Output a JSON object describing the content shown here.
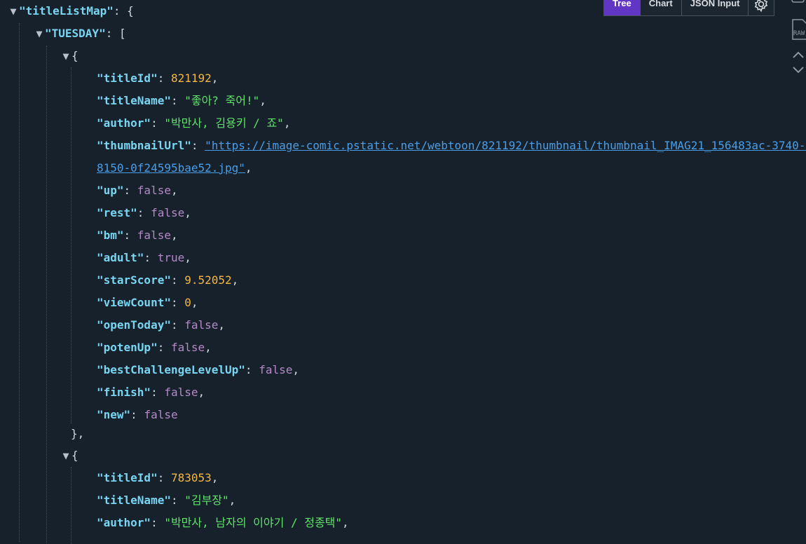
{
  "toolbar": {
    "tabs": [
      {
        "label": "Tree",
        "active": true
      },
      {
        "label": "Chart",
        "active": false
      },
      {
        "label": "JSON Input",
        "active": false
      }
    ],
    "settings_icon": "gear-icon"
  },
  "side_icons": [
    "raw-icon",
    "chevron-up-icon",
    "chevron-down-icon"
  ],
  "side_raw_label": "RAW",
  "colors": {
    "background": "#17212b",
    "key": "#78d6f2",
    "string": "#5fe36a",
    "number": "#f5b742",
    "boolean": "#b58ac7",
    "link": "#4a9ee8",
    "active_tab": "#6236c4"
  },
  "tree": {
    "root_key": "\"titleListMap\"",
    "root_open": ": {",
    "group_key": "\"TUESDAY\"",
    "group_open": ": [",
    "item1": {
      "open": "{",
      "fields": [
        {
          "key": "\"titleId\"",
          "value": "821192",
          "type": "num",
          "comma": ","
        },
        {
          "key": "\"titleName\"",
          "value": "\"좋아? 죽어!\"",
          "type": "str",
          "comma": ","
        },
        {
          "key": "\"author\"",
          "value": "\"박만사, 김용키 / 죠\"",
          "type": "str",
          "comma": ","
        },
        {
          "key": "\"thumbnailUrl\"",
          "value": "\"https://image-comic.pstatic.net/webtoon/821192/thumbnail/thumbnail_IMAG21_156483ac-3740-4cbf-",
          "value2": "8150-0f24595bae52.jpg\"",
          "type": "link",
          "comma": ","
        },
        {
          "key": "\"up\"",
          "value": "false",
          "type": "bool",
          "comma": ","
        },
        {
          "key": "\"rest\"",
          "value": "false",
          "type": "bool",
          "comma": ","
        },
        {
          "key": "\"bm\"",
          "value": "false",
          "type": "bool",
          "comma": ","
        },
        {
          "key": "\"adult\"",
          "value": "true",
          "type": "bool",
          "comma": ","
        },
        {
          "key": "\"starScore\"",
          "value": "9.52052",
          "type": "num",
          "comma": ","
        },
        {
          "key": "\"viewCount\"",
          "value": "0",
          "type": "num",
          "comma": ","
        },
        {
          "key": "\"openToday\"",
          "value": "false",
          "type": "bool",
          "comma": ","
        },
        {
          "key": "\"potenUp\"",
          "value": "false",
          "type": "bool",
          "comma": ","
        },
        {
          "key": "\"bestChallengeLevelUp\"",
          "value": "false",
          "type": "bool",
          "comma": ","
        },
        {
          "key": "\"finish\"",
          "value": "false",
          "type": "bool",
          "comma": ","
        },
        {
          "key": "\"new\"",
          "value": "false",
          "type": "bool",
          "comma": ""
        }
      ],
      "close": "},"
    },
    "item2": {
      "open": "{",
      "fields": [
        {
          "key": "\"titleId\"",
          "value": "783053",
          "type": "num",
          "comma": ","
        },
        {
          "key": "\"titleName\"",
          "value": "\"김부장\"",
          "type": "str",
          "comma": ","
        },
        {
          "key": "\"author\"",
          "value": "\"박만사, 남자의 이야기 / 정종택\"",
          "type": "str",
          "comma": ","
        }
      ]
    }
  }
}
